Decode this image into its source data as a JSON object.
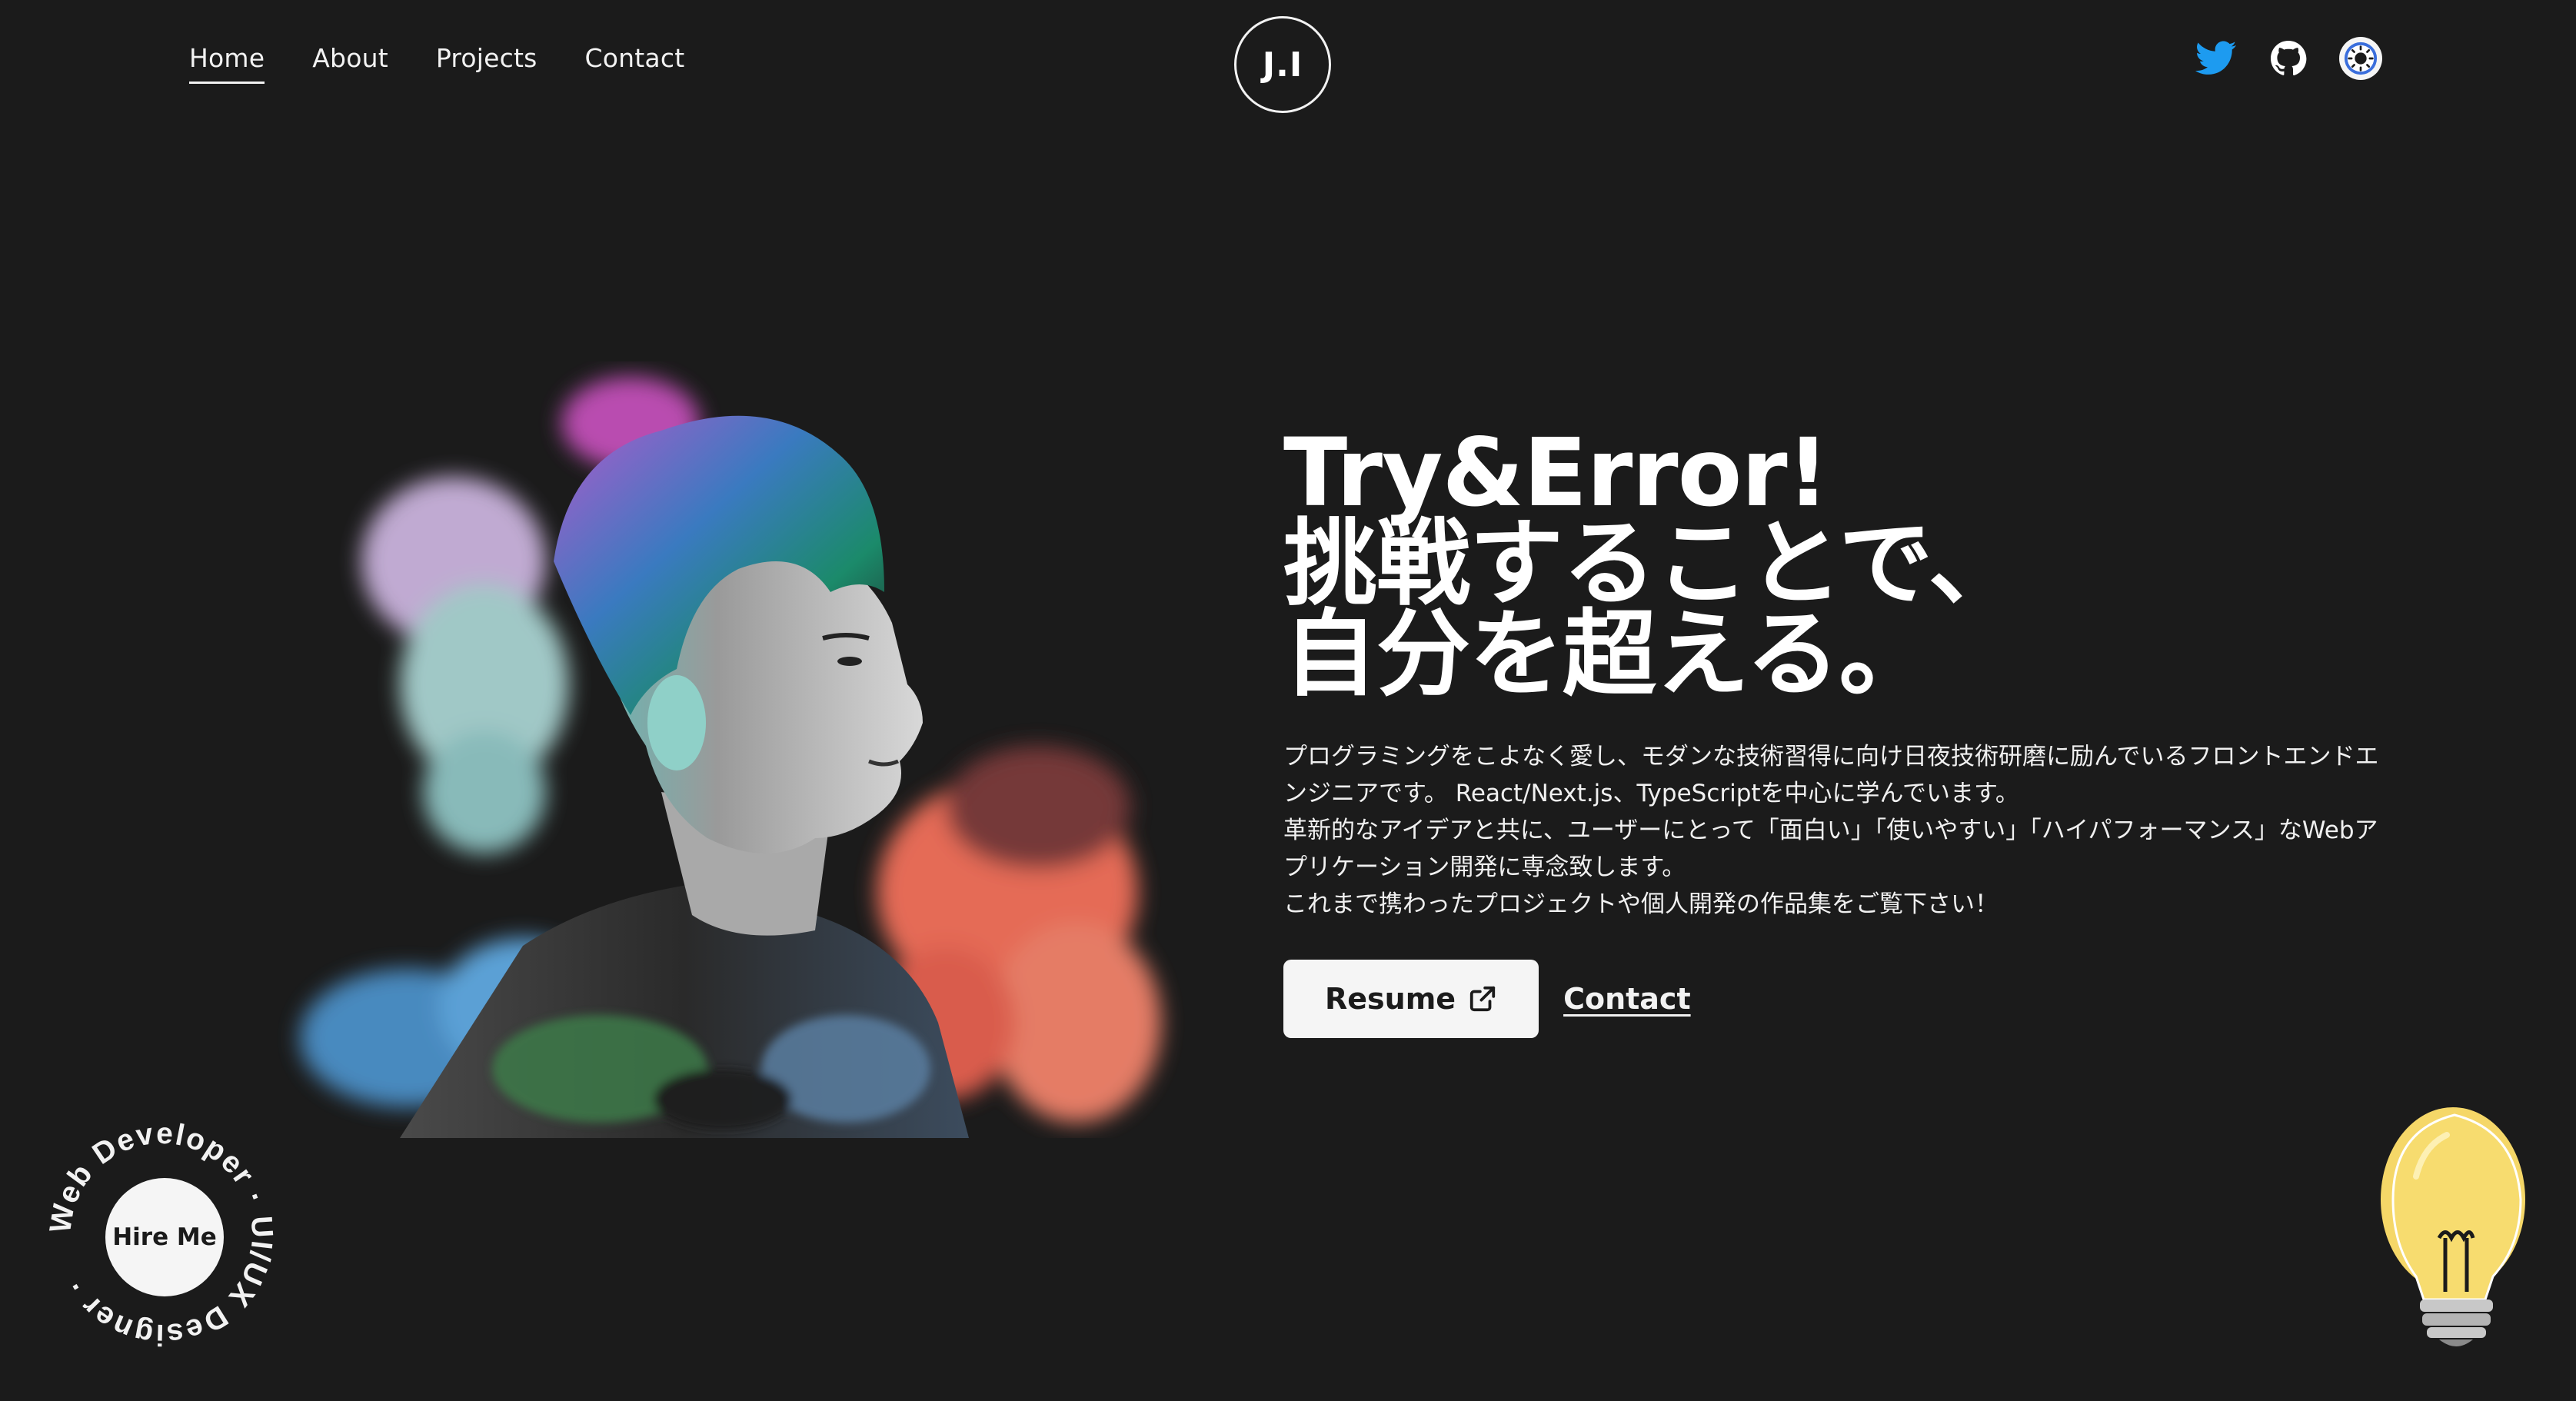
{
  "nav": {
    "links": [
      {
        "label": "Home",
        "active": true
      },
      {
        "label": "About",
        "active": false
      },
      {
        "label": "Projects",
        "active": false
      },
      {
        "label": "Contact",
        "active": false
      }
    ],
    "logo": "J.I",
    "social": [
      {
        "icon": "twitter-icon",
        "color": "#1d9bf0"
      },
      {
        "icon": "github-icon",
        "color": "#ffffff"
      },
      {
        "icon": "theme-toggle-icon",
        "color": "#3a6edc"
      }
    ]
  },
  "hero": {
    "headline": [
      "Try&Error!",
      "挑戦することで、",
      "自分を超える。"
    ],
    "intro": [
      "プログラミングをこよなく愛し、モダンな技術習得に向け日夜技術研磨に励んでいるフロントエンドエンジニアです。 React/Next.js、TypeScriptを中心に学んでいます。",
      "革新的なアイデアと共に、ユーザーにとって「面白い」「使いやすい」「ハイパフォーマンス」なWebアプリケーション開発に専念致します。",
      "これまで携わったプロジェクトや個人開発の作品集をご覧下さい！"
    ],
    "resume_label": "Resume",
    "contact_label": "Contact"
  },
  "hire": {
    "label": "Hire Me",
    "ring_text": "Web Developer · UI/UX Designer · "
  },
  "colors": {
    "background": "#1b1b1b",
    "text": "#f5f5f5",
    "twitter": "#1d9bf0"
  }
}
